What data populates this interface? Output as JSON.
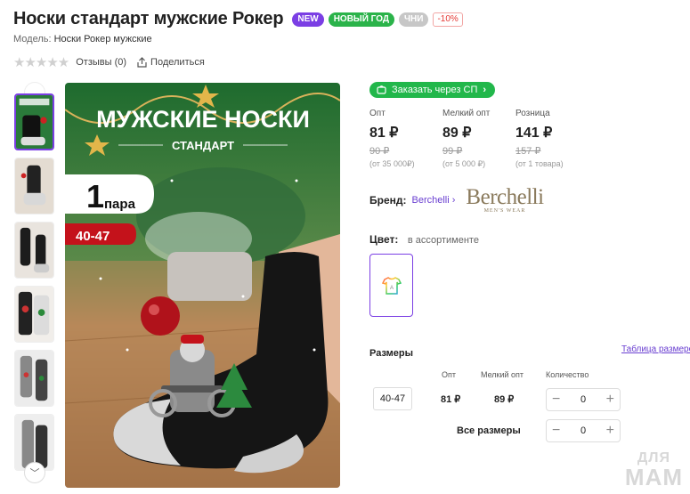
{
  "product": {
    "title": "Носки стандарт мужские Рокер",
    "badges": {
      "new": "NEW",
      "new_year": "НОВЫЙ ГОД",
      "chni": "ЧНИ",
      "discount": "-10%"
    },
    "model_label": "Модель:",
    "model_value": "Носки Рокер мужские",
    "reviews": "Отзывы (0)",
    "share": "Поделиться",
    "rating": 0
  },
  "main_image": {
    "headline": "МУЖСКИЕ НОСКИ",
    "subline": "СТАНДАРТ",
    "pack_count": "1",
    "pack_word": "пара",
    "size_tag": "40-47"
  },
  "joint_purchase": {
    "label": "Заказать через СП"
  },
  "prices": [
    {
      "label": "Опт",
      "price": "81 ₽",
      "old": "90 ₽",
      "note": "(от 35 000₽)"
    },
    {
      "label": "Мелкий опт",
      "price": "89 ₽",
      "old": "99 ₽",
      "note": "(от 5 000 ₽)"
    },
    {
      "label": "Розница",
      "price": "141 ₽",
      "old": "157 ₽",
      "note": "(от 1 товара)"
    }
  ],
  "brand": {
    "label": "Бренд:",
    "name": "Berchelli",
    "logo_main": "Berchelli",
    "logo_sub": "MEN'S WEAR"
  },
  "color": {
    "label": "Цвет:",
    "value": "в ассортименте"
  },
  "sizes": {
    "label": "Размеры",
    "table_link": "Таблица размеров",
    "headers": {
      "opt": "Опт",
      "small_opt": "Мелкий опт",
      "qty": "Количество"
    },
    "rows": [
      {
        "size": "40-47",
        "opt": "81 ₽",
        "small_opt": "89 ₽",
        "qty": "0"
      }
    ],
    "all_sizes_label": "Все размеры",
    "all_sizes_qty": "0"
  },
  "watermark": {
    "line1": "ДЛЯ",
    "line2": "МАМ"
  },
  "colors": {
    "accent": "#7b3fe4",
    "green": "#22b74b",
    "sale_red": "#e53935"
  }
}
